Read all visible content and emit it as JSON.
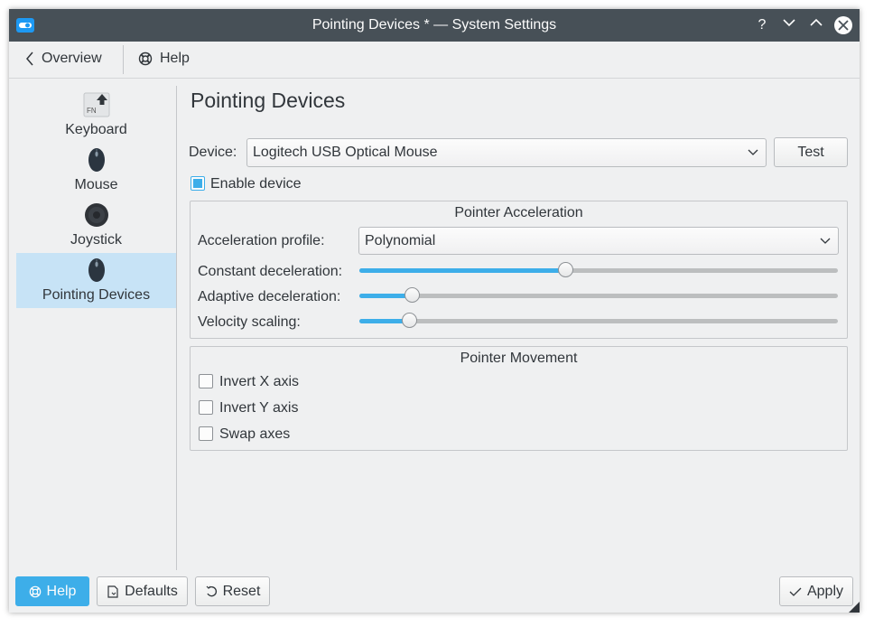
{
  "window": {
    "title": "Pointing Devices * — System Settings"
  },
  "titlebar_buttons": {
    "help": "?",
    "minimize": "⌄",
    "maximize": "⌃",
    "close": "✕"
  },
  "toolbar": {
    "overview_label": "Overview",
    "help_label": "Help"
  },
  "sidebar": {
    "items": [
      {
        "label": "Keyboard",
        "icon": "keyboard-icon",
        "selected": false
      },
      {
        "label": "Mouse",
        "icon": "mouse-icon",
        "selected": false
      },
      {
        "label": "Joystick",
        "icon": "joystick-icon",
        "selected": false
      },
      {
        "label": "Pointing Devices",
        "icon": "pointing-device-icon",
        "selected": true
      }
    ],
    "keyboard_key_text": "FN"
  },
  "page": {
    "title": "Pointing Devices",
    "device_label": "Device:",
    "device_value": "Logitech USB Optical Mouse",
    "test_button": "Test",
    "enable_device_label": "Enable device",
    "enable_device_checked": true,
    "acceleration": {
      "group_title": "Pointer Acceleration",
      "profile_label": "Acceleration profile:",
      "profile_value": "Polynomial",
      "constant_label": "Constant deceleration:",
      "constant_level": 0.43,
      "adaptive_label": "Adaptive deceleration:",
      "adaptive_level": 0.11,
      "velocity_label": "Velocity scaling:",
      "velocity_level": 0.104
    },
    "movement": {
      "group_title": "Pointer Movement",
      "invert_x": "Invert X axis",
      "invert_x_checked": false,
      "invert_y": "Invert Y axis",
      "invert_y_checked": false,
      "swap_axes": "Swap axes",
      "swap_axes_checked": false
    }
  },
  "footer": {
    "help_label": "Help",
    "defaults_label": "Defaults",
    "reset_label": "Reset",
    "apply_label": "Apply"
  },
  "colors": {
    "accent": "#3daee9",
    "titlebar": "#475057",
    "window_bg": "#eff0f1",
    "selection": "#c7e3f6"
  }
}
